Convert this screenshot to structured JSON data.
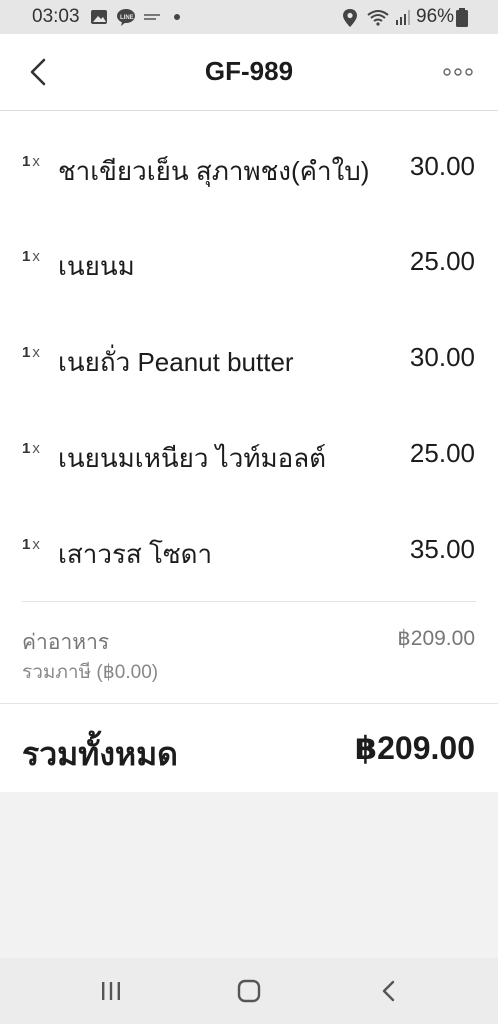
{
  "status_bar": {
    "time": "03:03",
    "battery": "96%",
    "icons": [
      "gallery-icon",
      "line-icon",
      "notification-icon",
      "dot-icon",
      "location-icon",
      "wifi-icon",
      "signal-icon",
      "battery-icon"
    ]
  },
  "header": {
    "title": "GF-989",
    "back_icon": "chevron-left-icon",
    "more_icon": "more-dots-icon"
  },
  "items": [
    {
      "qty": "1",
      "x": "x",
      "name": "ชาเขียวเย็น สุภาพชง(คำใบ)",
      "price": "30.00"
    },
    {
      "qty": "1",
      "x": "x",
      "name": "เนยนม",
      "price": "25.00"
    },
    {
      "qty": "1",
      "x": "x",
      "name": "เนยถั่ว Peanut butter",
      "price": "30.00"
    },
    {
      "qty": "1",
      "x": "x",
      "name": "เนยนมเหนียว ไวท์มอลต์",
      "price": "25.00"
    },
    {
      "qty": "1",
      "x": "x",
      "name": "เสาวรส โซดา",
      "price": "35.00"
    }
  ],
  "summary": {
    "subtotal_label": "ค่าอาหาร",
    "tax_label": "รวมภาษี (฿0.00)",
    "subtotal_value": "฿209.00",
    "total_label": "รวมทั้งหมด",
    "total_value": "฿209.00"
  },
  "nav_bar": {
    "buttons": [
      "recents-icon",
      "home-icon",
      "back-icon"
    ]
  },
  "colors": {
    "header_bg": "#ffffff",
    "page_bg": "#f2f2f2",
    "text": "#1c1c1c",
    "muted": "#777777"
  }
}
